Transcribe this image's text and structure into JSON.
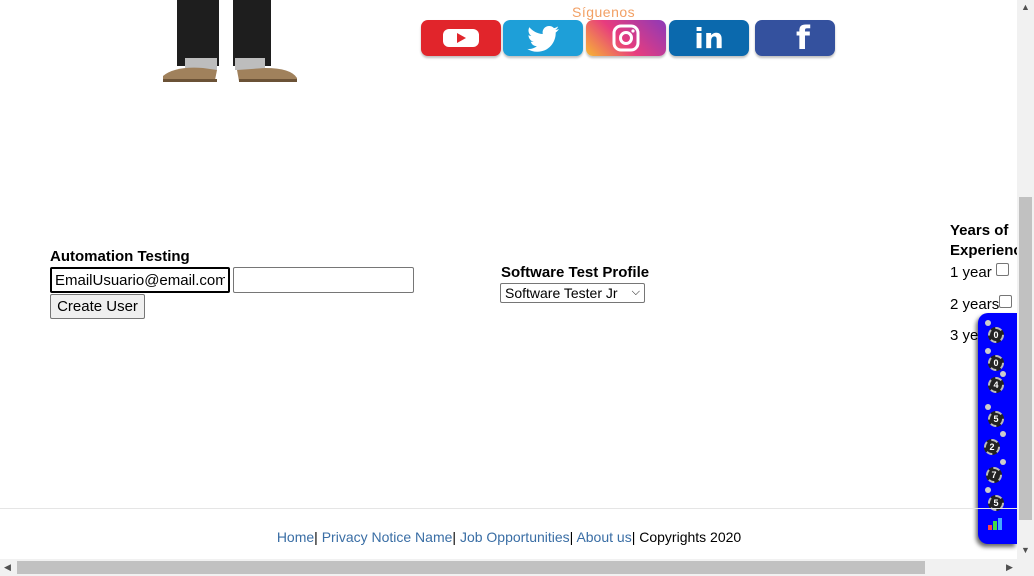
{
  "banner": {
    "follow_text": "Síguenos",
    "icons": [
      "youtube-icon",
      "twitter-icon",
      "instagram-icon",
      "linkedin-icon",
      "facebook-icon"
    ],
    "linkedin_text": "in",
    "facebook_text": "f"
  },
  "form": {
    "title": "Automation Testing",
    "email_value": "EmailUsuario@email.com",
    "password_value": "",
    "create_button": "Create User"
  },
  "profile": {
    "title": "Software Test Profile",
    "selected": "Software Tester Jr"
  },
  "experience": {
    "title_line1": "Years of",
    "title_line2": "Experienc",
    "options": [
      "1 year",
      "2 years",
      "3 ye"
    ]
  },
  "widget": {
    "digits": [
      "0",
      "0",
      "4",
      "5",
      "2",
      "7",
      "5"
    ]
  },
  "footer": {
    "home": "Home",
    "privacy": "Privacy Notice Name",
    "jobs": "Job Opportunities",
    "about": "About us",
    "copyright": "Copyrights 2020",
    "separator": "|"
  },
  "colors": {
    "link": "#3a6ea5",
    "widget_bg": "#0000ff"
  }
}
